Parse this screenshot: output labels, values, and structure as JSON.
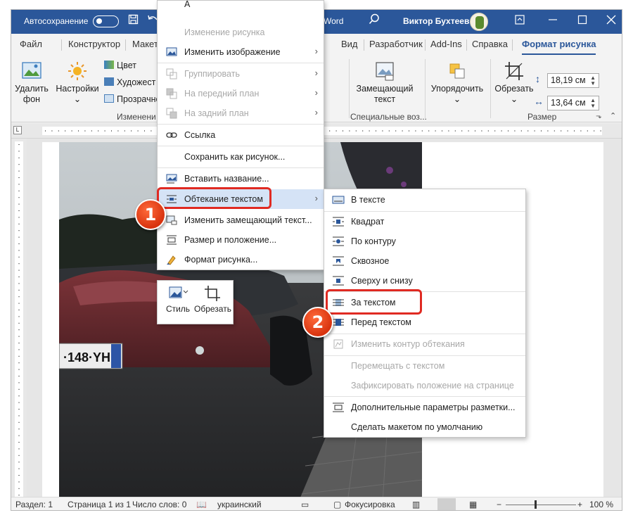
{
  "titlebar": {
    "autosave_label": "Автосохранение",
    "doc_title": "Word",
    "user_name": "Виктор Бухтеев"
  },
  "tabs": [
    {
      "label": "Файл"
    },
    {
      "label": "Конструктор"
    },
    {
      "label": "Макет"
    },
    {
      "label": "Вид"
    },
    {
      "label": "Разработчик"
    },
    {
      "label": "Add-Ins"
    },
    {
      "label": "Справка"
    },
    {
      "label": "Формат рисунка"
    }
  ],
  "ribbon": {
    "remove_bg_line1": "Удалить",
    "remove_bg_line2": "фон",
    "corrections": "Настройки",
    "color": "Цвет",
    "artistic": "Художест",
    "transparency": "Прозрачно",
    "group_adjust": "Изменени",
    "alt_text_line1": "Замещающий",
    "alt_text_line2": "текст",
    "group_accessibility": "Специальные воз...",
    "arrange": "Упорядочить",
    "crop": "Обрезать",
    "height": "18,19 см",
    "width": "13,64 см",
    "group_size": "Размер"
  },
  "context_menu": {
    "top_partial": "A",
    "items": [
      {
        "label": "Изменение рисунка",
        "disabled": true
      },
      {
        "label": "Изменить изображение",
        "submenu": true
      },
      {
        "label": "Группировать",
        "disabled": true,
        "submenu": true
      },
      {
        "label": "На передний план",
        "disabled": true,
        "submenu": true
      },
      {
        "label": "На задний план",
        "disabled": true,
        "submenu": true
      },
      {
        "label": "Ссылка"
      },
      {
        "label": "Сохранить как рисунок..."
      },
      {
        "label": "Вставить название..."
      },
      {
        "label": "Обтекание текстом",
        "submenu": true,
        "highlighted": true
      },
      {
        "label": "Изменить замещающий текст..."
      },
      {
        "label": "Размер и положение..."
      },
      {
        "label": "Формат рисунка..."
      }
    ]
  },
  "mini_toolbar": {
    "style": "Стиль",
    "crop": "Обрезать"
  },
  "submenu": {
    "items": [
      {
        "label": "В тексте"
      },
      {
        "label": "Квадрат"
      },
      {
        "label": "По контуру"
      },
      {
        "label": "Сквозное"
      },
      {
        "label": "Сверху и снизу"
      },
      {
        "label": "За текстом",
        "highlighted": true
      },
      {
        "label": "Перед текстом"
      },
      {
        "label": "Изменить контур обтекания",
        "disabled": true
      },
      {
        "label": "Перемещать с текстом",
        "disabled": true
      },
      {
        "label": "Зафиксировать положение на странице",
        "disabled": true
      },
      {
        "label": "Дополнительные параметры разметки..."
      },
      {
        "label": "Сделать макетом по умолчанию"
      }
    ]
  },
  "callouts": {
    "one": "1",
    "two": "2"
  },
  "photo": {
    "plate": "·148·YH"
  },
  "statusbar": {
    "section": "Раздел: 1",
    "page": "Страница 1 из 1",
    "words": "Число слов: 0",
    "language": "украинский",
    "focus": "Фокусировка",
    "zoom": "100 %"
  },
  "colors": {
    "accent": "#2b579a",
    "highlight": "#d5e3f6",
    "callout": "#e02a22"
  }
}
